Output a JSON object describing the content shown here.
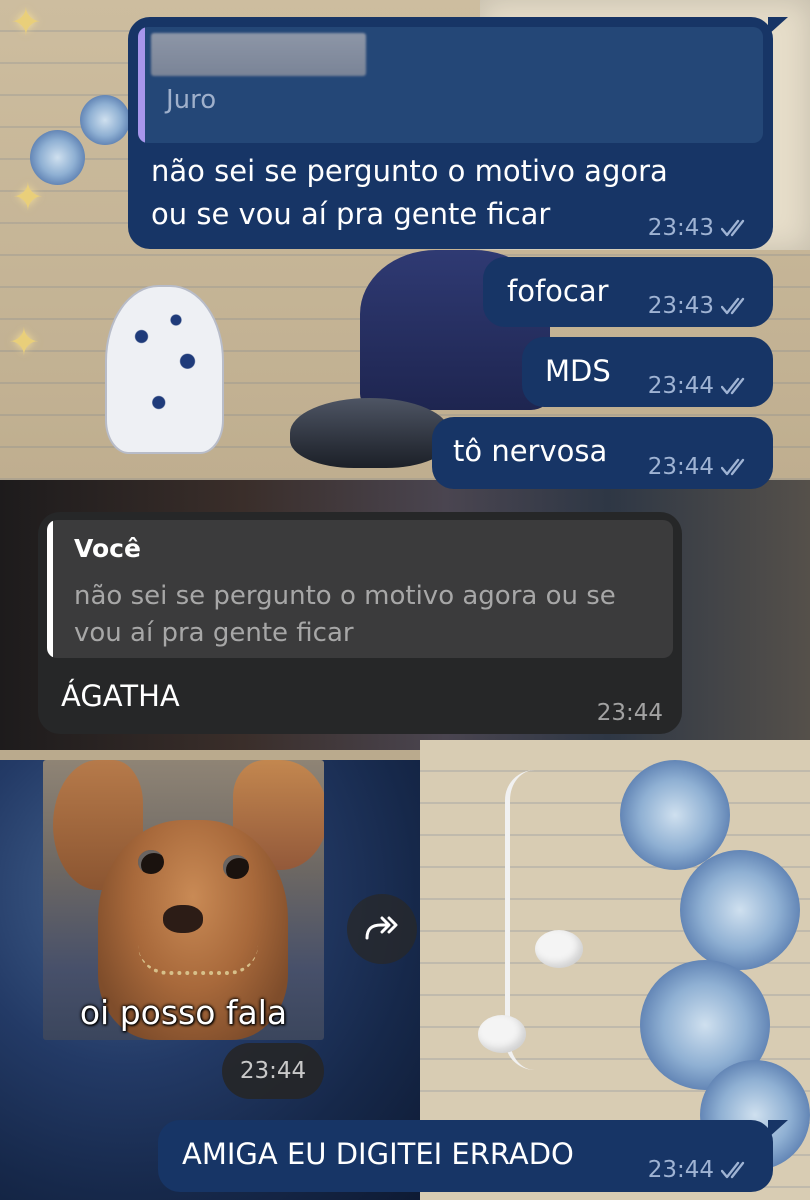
{
  "messages": [
    {
      "id": "m1",
      "direction": "outgoing",
      "reply": {
        "sender": "",
        "sender_obscured": true,
        "text": "Juro"
      },
      "lines": [
        "não sei se pergunto o motivo agora",
        "ou se vou aí pra gente ficar"
      ],
      "time": "23:43",
      "status": "read"
    },
    {
      "id": "m2",
      "direction": "outgoing",
      "text": "fofocar",
      "time": "23:43",
      "status": "read"
    },
    {
      "id": "m3",
      "direction": "outgoing",
      "text": "MDS",
      "time": "23:44",
      "status": "read"
    },
    {
      "id": "m4",
      "direction": "outgoing",
      "text": "tô nervosa",
      "time": "23:44",
      "status": "read"
    },
    {
      "id": "m5",
      "direction": "incoming",
      "reply": {
        "sender": "Você",
        "text": "não sei se pergunto o motivo agora ou se vou aí pra gente ficar"
      },
      "text": "ÁGATHA",
      "time": "23:44"
    },
    {
      "id": "m6",
      "direction": "incoming",
      "type": "sticker",
      "caption": "oi posso fala",
      "time": "23:44",
      "forward_icon": "forward-icon"
    },
    {
      "id": "m7",
      "direction": "outgoing",
      "text": "AMIGA EU DIGITEI ERRADO",
      "time": "23:44",
      "status": "read"
    }
  ],
  "colors": {
    "outgoing_bubble": "#173566",
    "incoming_bubble": "#262728",
    "reply_accent_outgoing": "#a896ec",
    "reply_accent_incoming": "#ffffff",
    "meta_outgoing": "#9fb3d3",
    "meta_incoming": "#a2a2a2"
  },
  "icons": {
    "read_receipt": "double-check-icon",
    "forward": "forward-icon"
  }
}
